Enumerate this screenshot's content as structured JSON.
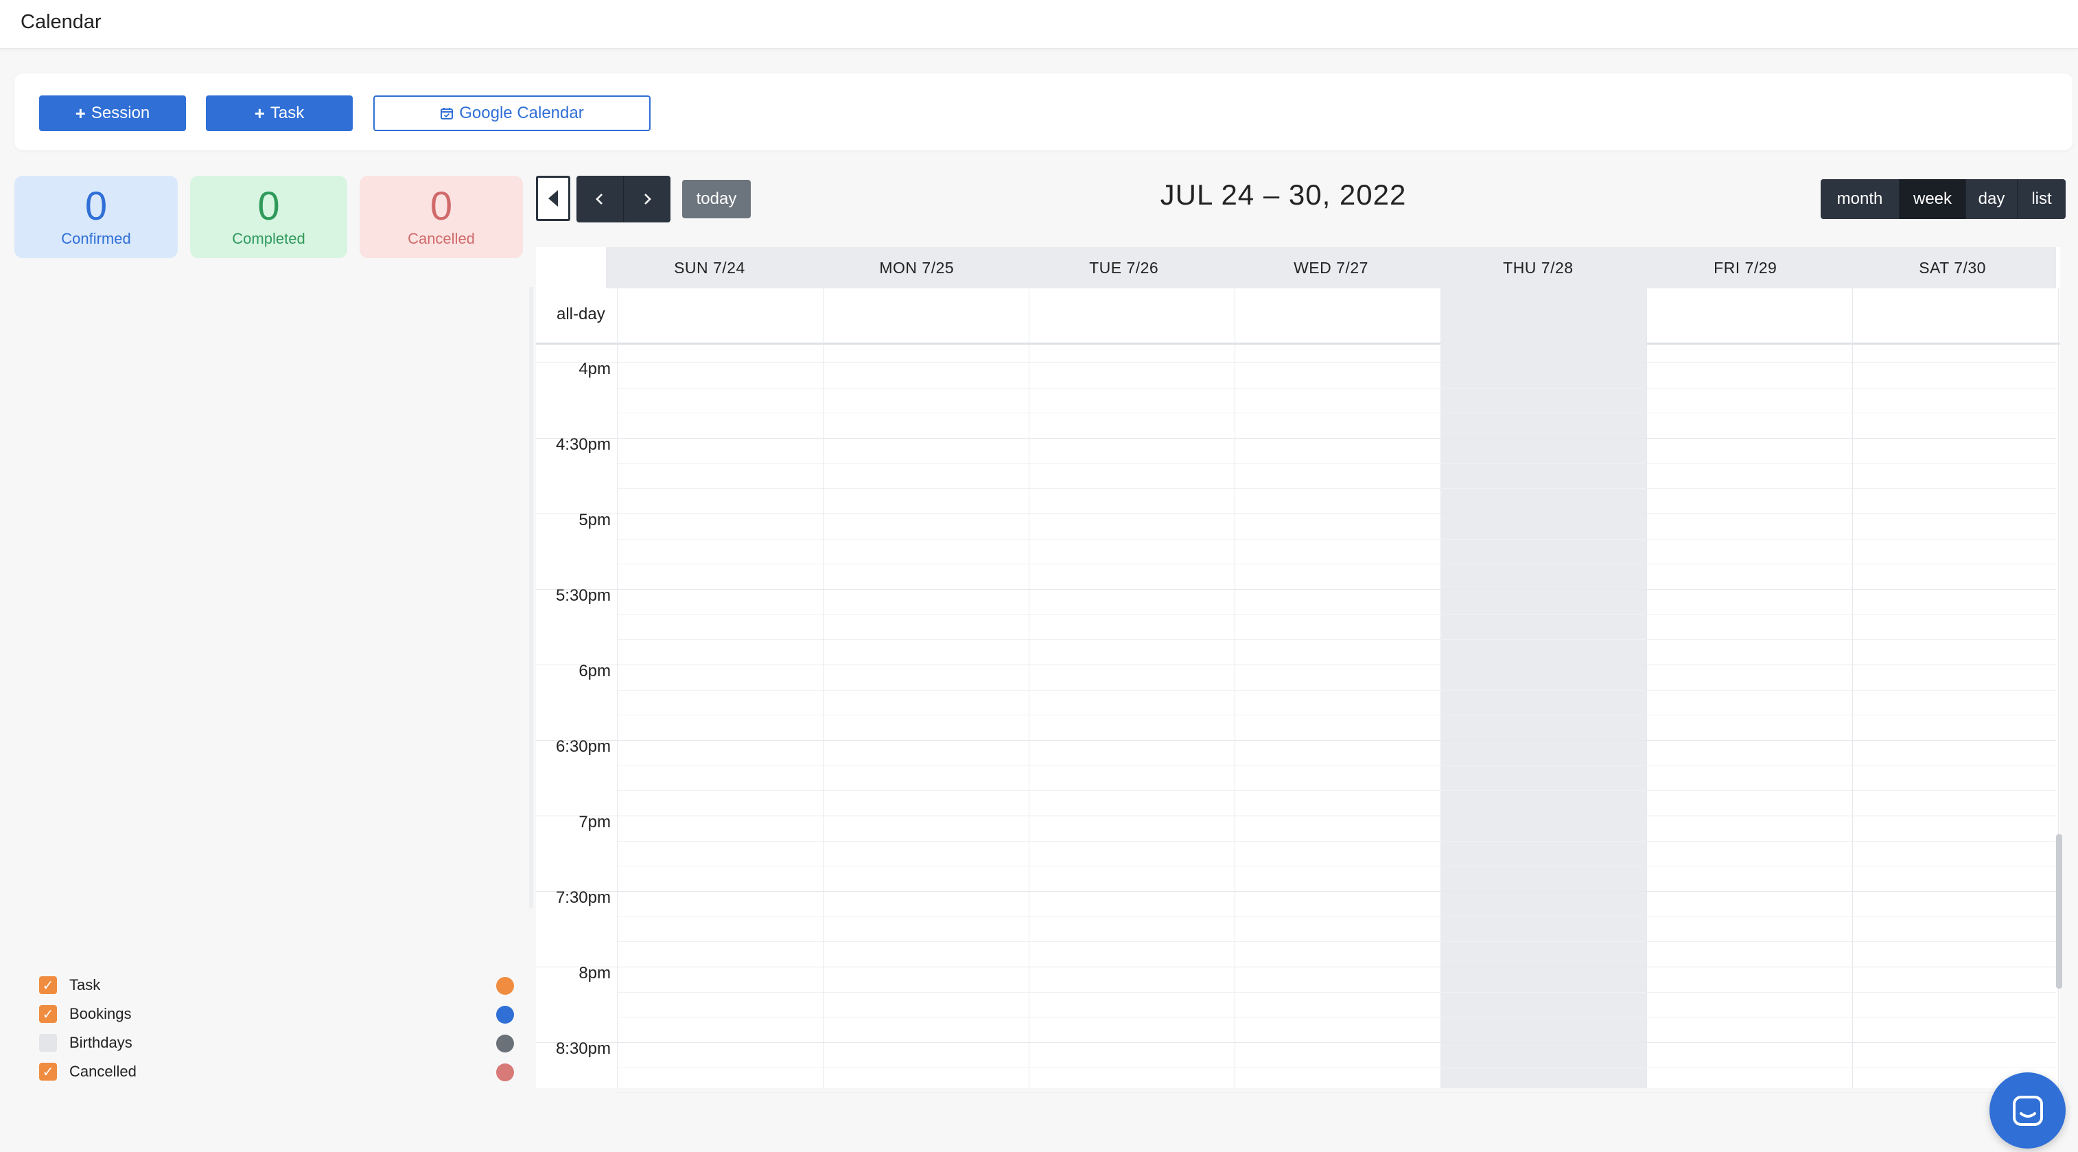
{
  "app": {
    "title": "Calendar"
  },
  "actions": {
    "session_label": "Session",
    "task_label": "Task",
    "google_calendar_label": "Google Calendar"
  },
  "stats": [
    {
      "value": "0",
      "label": "Confirmed",
      "color": "#2f6fd6"
    },
    {
      "value": "0",
      "label": "Completed",
      "color": "#2f9a5a"
    },
    {
      "value": "0",
      "label": "Cancelled",
      "color": "#d06a6a"
    }
  ],
  "filters": [
    {
      "label": "Task",
      "checked": true,
      "color": "#f08c3f"
    },
    {
      "label": "Bookings",
      "checked": true,
      "color": "#2f6fd6"
    },
    {
      "label": "Birthdays",
      "checked": false,
      "color": "#6b7179"
    },
    {
      "label": "Cancelled",
      "checked": true,
      "color": "#d77a78"
    }
  ],
  "toolbar": {
    "prev_icon": "chevron-left-icon",
    "next_icon": "chevron-right-icon",
    "today_label": "today",
    "range_title": "JUL 24 – 30, 2022",
    "views": [
      "month",
      "week",
      "day",
      "list"
    ],
    "active_view": "week"
  },
  "week": {
    "days": [
      "SUN 7/24",
      "MON 7/25",
      "TUE 7/26",
      "WED 7/27",
      "THU 7/28",
      "FRI 7/29",
      "SAT 7/30"
    ],
    "today_day": "THU 7/28",
    "allday_label": "all-day",
    "time_labels": [
      "4pm",
      "4:30pm",
      "5pm",
      "5:30pm",
      "6pm",
      "6:30pm",
      "7pm",
      "7:30pm",
      "8pm",
      "8:30pm"
    ]
  },
  "colors": {
    "primary": "#2f6fd6",
    "dark": "#2c3440",
    "today_bg": "#e9ebee"
  }
}
